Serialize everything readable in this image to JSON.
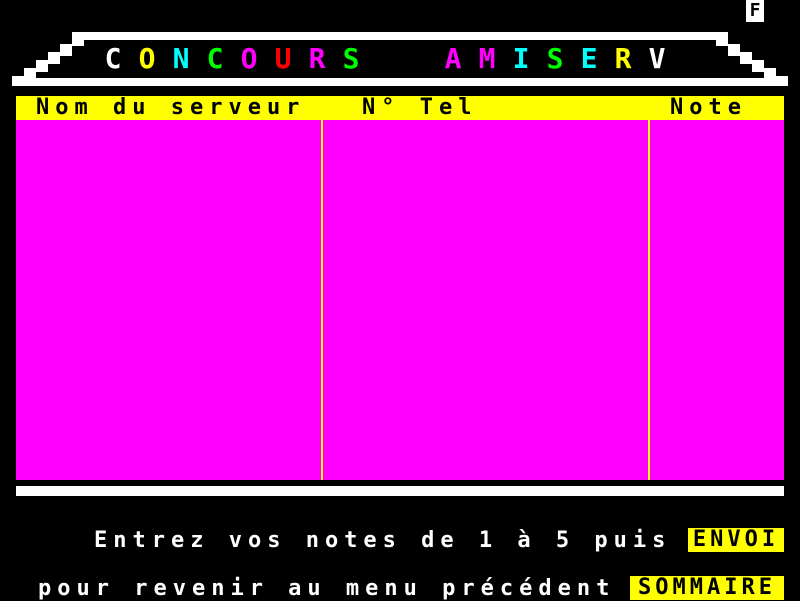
{
  "status": {
    "indicator": "F"
  },
  "banner": {
    "title_left": [
      {
        "char": "C",
        "color": "#ffffff"
      },
      {
        "char": "O",
        "color": "#ffff00"
      },
      {
        "char": "N",
        "color": "#00ffff"
      },
      {
        "char": "C",
        "color": "#00ff00"
      },
      {
        "char": "O",
        "color": "#ff00ff"
      },
      {
        "char": "U",
        "color": "#ff0000"
      },
      {
        "char": "R",
        "color": "#ff00ff"
      },
      {
        "char": "S",
        "color": "#00ff00"
      }
    ],
    "title_right": [
      {
        "char": "A",
        "color": "#ff00ff"
      },
      {
        "char": "M",
        "color": "#ff00ff"
      },
      {
        "char": "I",
        "color": "#00ffff"
      },
      {
        "char": "S",
        "color": "#00ff00"
      },
      {
        "char": "E",
        "color": "#00ffff"
      },
      {
        "char": "R",
        "color": "#ffff00"
      },
      {
        "char": "V",
        "color": "#ffffff"
      }
    ]
  },
  "table": {
    "headers": [
      "Nom du serveur",
      "N° Tel",
      "Note"
    ],
    "header_color": "#ffff00",
    "body_color": "#ff00ff",
    "rows": []
  },
  "footer": {
    "line1": "Entrez vos notes de 1 à 5 puis",
    "send_label": "ENVOI",
    "line2": "pour revenir au menu précédent",
    "menu_label": "SOMMAIRE"
  }
}
